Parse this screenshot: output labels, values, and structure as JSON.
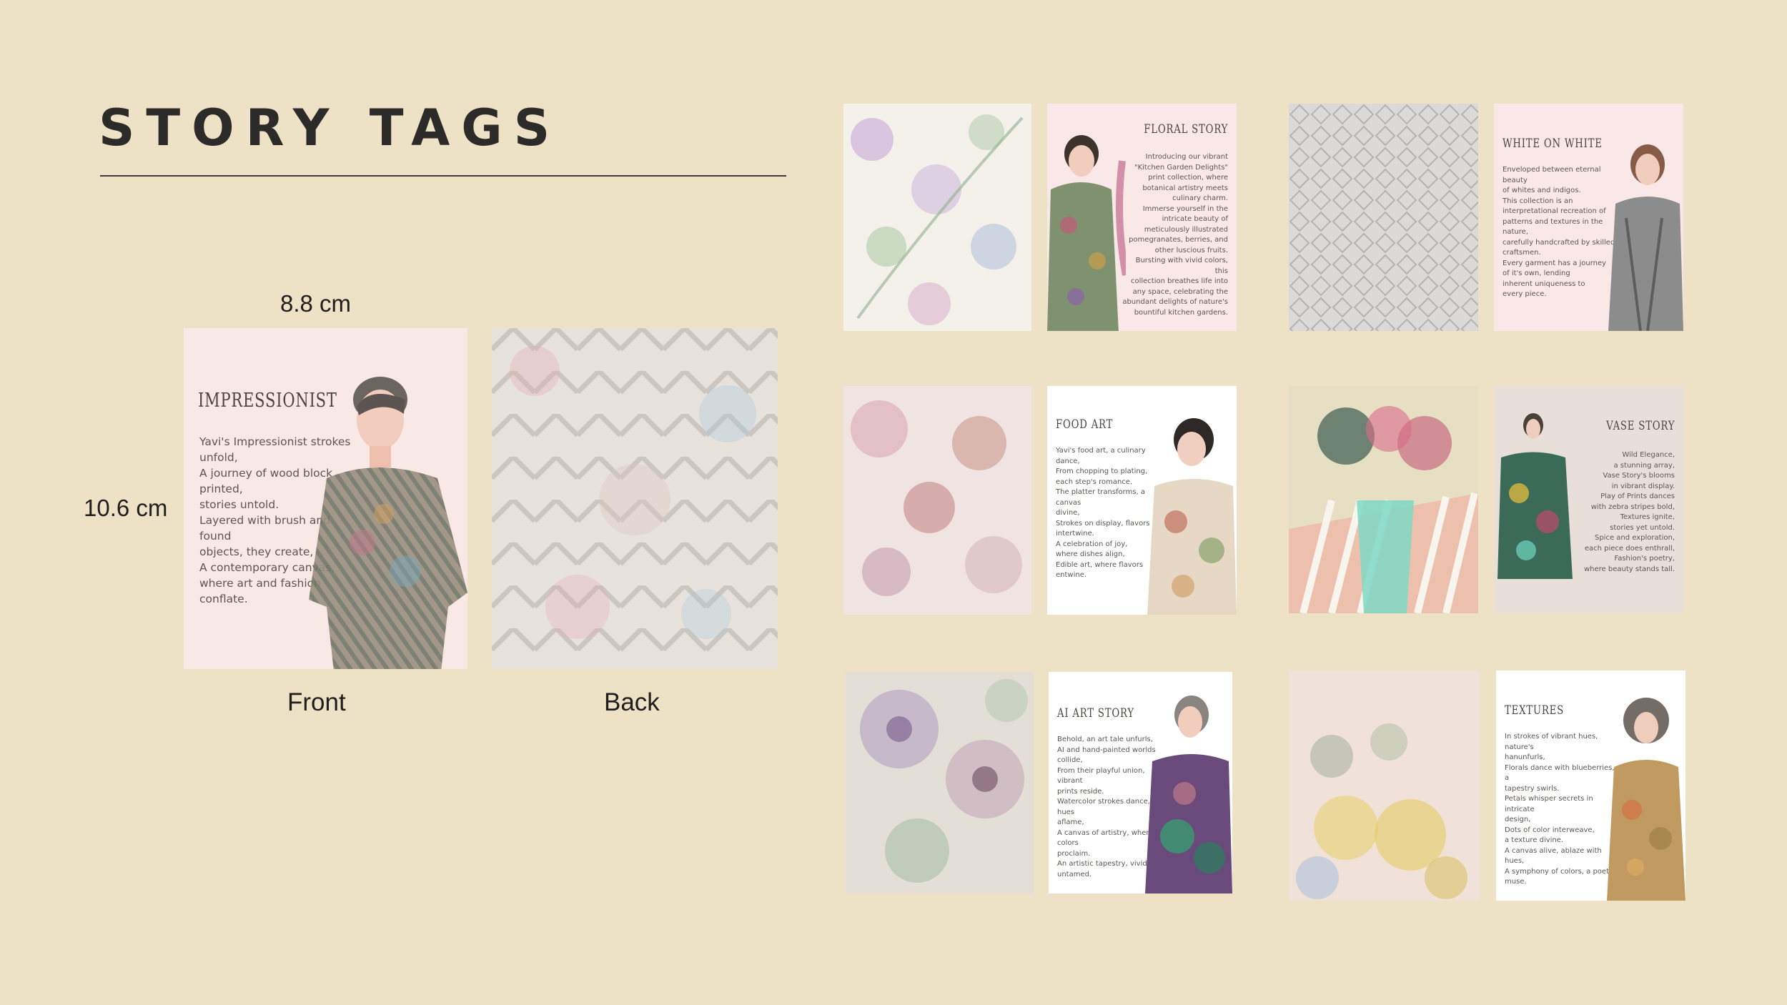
{
  "page": {
    "title": "STORY TAGS"
  },
  "dimensions": {
    "width": "8.8 cm",
    "height": "10.6 cm"
  },
  "captions": {
    "front": "Front",
    "back": "Back"
  },
  "main_tag": {
    "title": "IMPRESSIONIST",
    "body": "Yavi's Impressionist strokes\nunfold,\nA journey of wood block printed,\nstories untold.\nLayered with brush and found\nobjects, they create,\nA contemporary canvas,\nwhere art and fashion\nconflate."
  },
  "tags": [
    {
      "title": "FLORAL STORY",
      "body": "Introducing our vibrant\n\"Kitchen Garden Delights\"\nprint collection, where\nbotanical artistry meets\nculinary charm.\nImmerse yourself in the\nintricate beauty of\nmeticulously illustrated\npomegranates, berries, and\nother luscious fruits.\nBursting with vivid colors, this\ncollection breathes life into\nany space, celebrating the\nabundant delights of nature's\nbountiful kitchen gardens."
    },
    {
      "title": "WHITE ON WHITE",
      "body": "Enveloped between eternal beauty\nof whites and indigos.\nThis collection is an\ninterpretational recreation of\npatterns and textures in the nature,\ncarefully handcrafted by skilled\ncraftsmen.\nEvery garment has a journey\nof it's own, lending\ninherent uniqueness to\nevery piece."
    },
    {
      "title": "FOOD ART",
      "body": "Yavi's food art, a culinary dance,\nFrom chopping to plating,\neach step's romance.\nThe platter transforms, a canvas\ndivine,\nStrokes on display, flavors\nintertwine.\nA celebration of joy,\nwhere dishes align,\nEdible art, where flavors\nentwine."
    },
    {
      "title": "VASE STORY",
      "body": "Wild Elegance,\na stunning array,\nVase Story's blooms\nin vibrant display.\nPlay of Prints dances\nwith zebra stripes bold,\nTextures ignite,\nstories yet untold.\nSpice and exploration,\neach piece does enthrall,\nFashion's poetry,\nwhere beauty stands tall."
    },
    {
      "title": "AI ART STORY",
      "body": "Behold, an art tale unfurls,\nAI and hand-painted worlds collide,\nFrom their playful union, vibrant\nprints reside.\nWatercolor strokes dance, hues\naflame,\nA canvas of artistry, where colors\nproclaim.\nAn artistic tapestry, vivid and\nuntamed."
    },
    {
      "title": "TEXTURES",
      "body": "In strokes of vibrant hues, nature's\nhanunfurls,\nFlorals dance with blueberries, a\ntapestry swirls.\nPetals whisper secrets in intricate\ndesign,\nDots of color interweave,\na texture divine.\nA canvas alive, ablaze with hues,\nA symphony of colors, a poet's\nmuse."
    }
  ],
  "colors": {
    "background": "#ede2c5",
    "tag_pink": "#f9e8e7",
    "text": "#2b2a28"
  }
}
